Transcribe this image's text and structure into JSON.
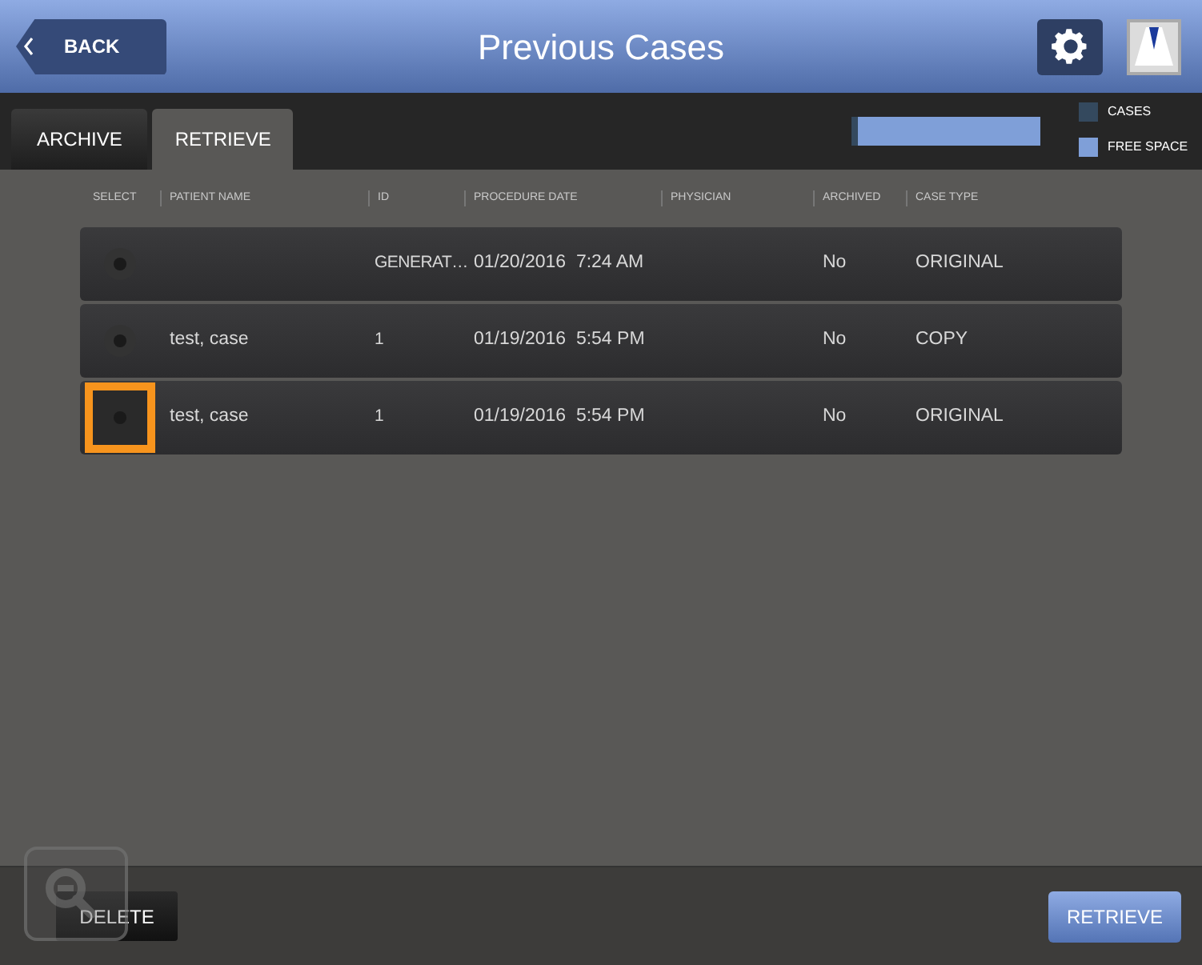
{
  "header": {
    "back": "BACK",
    "title": "Previous Cases"
  },
  "tabs": [
    {
      "label": "ARCHIVE",
      "selected": false
    },
    {
      "label": "RETRIEVE",
      "selected": true
    }
  ],
  "storage": {
    "level": 0.03,
    "legend": [
      {
        "label": "CASES",
        "color": "#34495e"
      },
      {
        "label": "FREE SPACE",
        "color": "#7f9fd8"
      }
    ]
  },
  "table": {
    "columns": [
      "SELECT",
      "PATIENT NAME",
      "ID",
      "PROCEDURE DATE",
      "PHYSICIAN",
      "ARCHIVED",
      "CASE TYPE"
    ],
    "rows": [
      {
        "selected": false,
        "patient_name": "",
        "id": "GENERAT…",
        "procedure_date": "01/20/2016  7:24 AM",
        "physician": "",
        "archived": "No",
        "case_type": "ORIGINAL"
      },
      {
        "selected": false,
        "patient_name": "test, case",
        "id": "1",
        "procedure_date": "01/19/2016  5:54 PM",
        "physician": "",
        "archived": "No",
        "case_type": "COPY"
      },
      {
        "selected": true,
        "patient_name": "test, case",
        "id": "1",
        "procedure_date": "01/19/2016  5:54 PM",
        "physician": "",
        "archived": "No",
        "case_type": "ORIGINAL"
      }
    ]
  },
  "footer": {
    "delete": "DELETE",
    "retrieve": "RETRIEVE"
  }
}
